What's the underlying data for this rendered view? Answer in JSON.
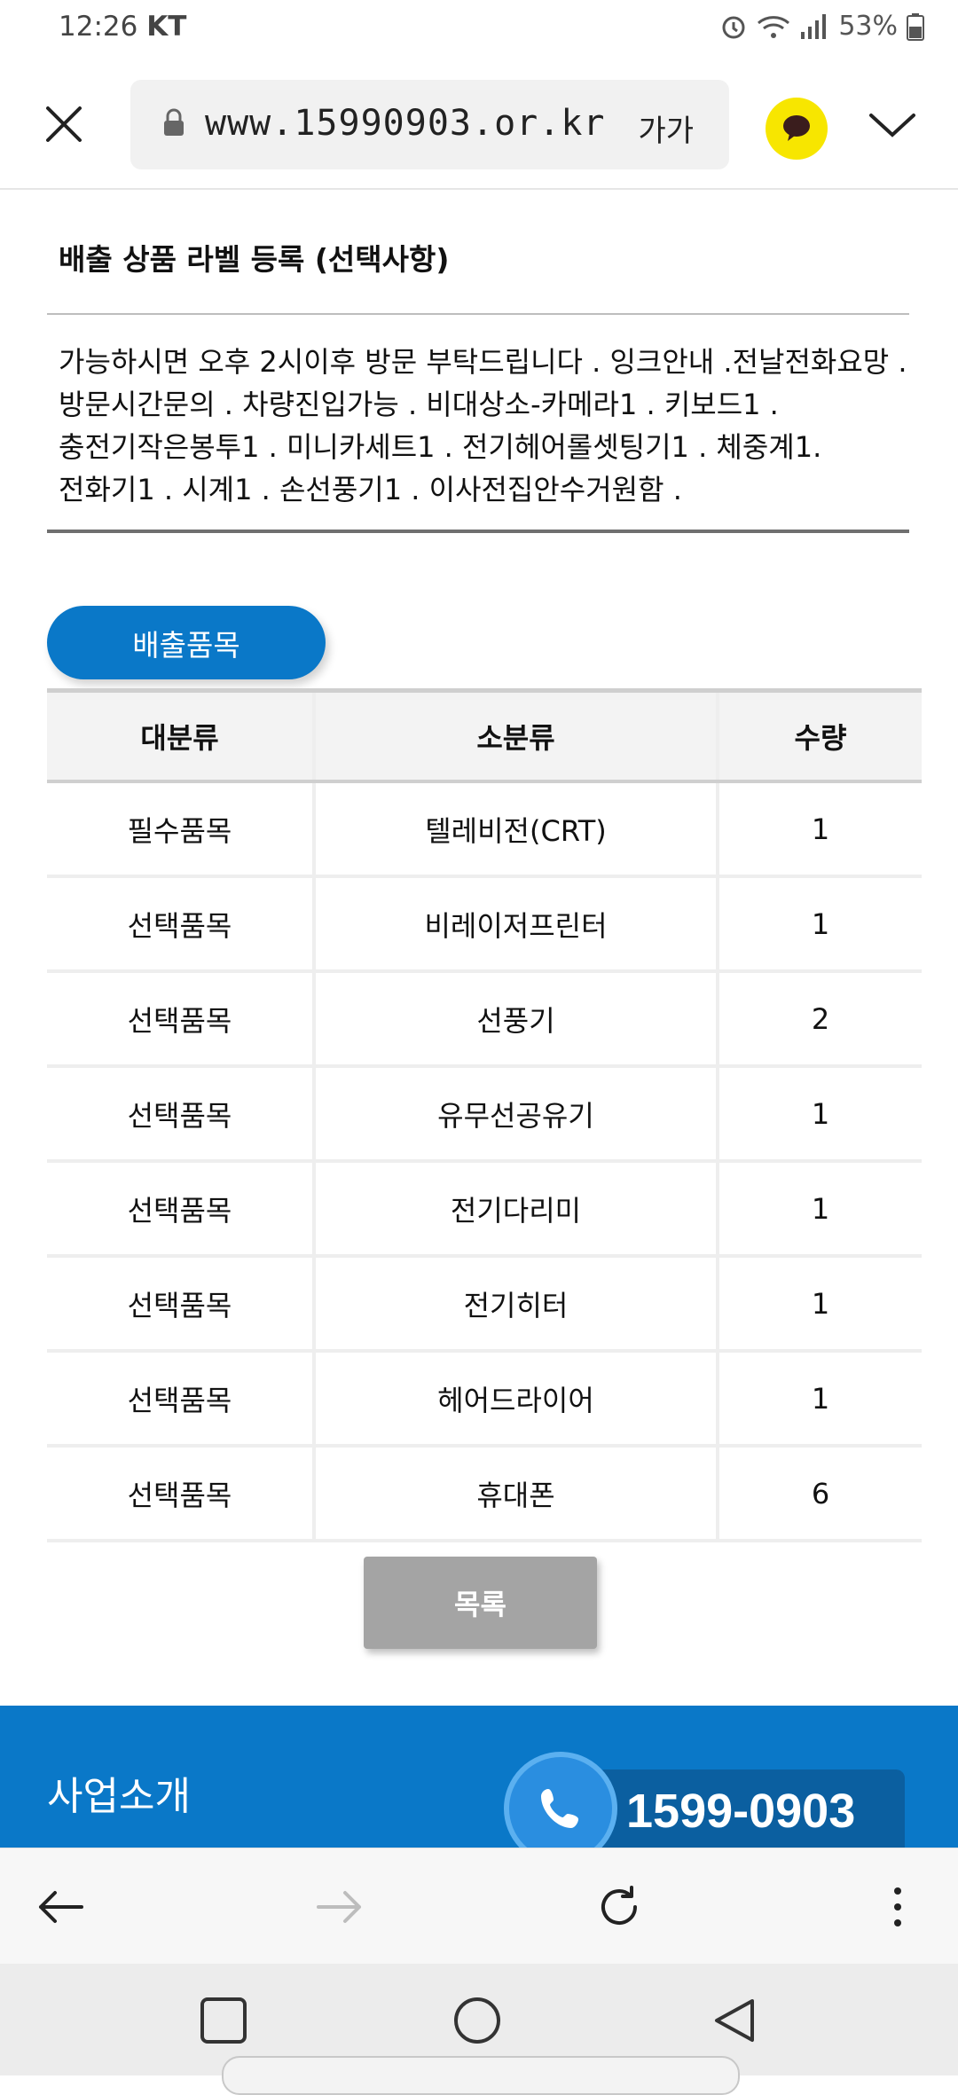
{
  "status_bar": {
    "time": "12:26",
    "carrier": "KT",
    "battery": "53%"
  },
  "browser": {
    "url": "www.15990903.or.kr",
    "text_size_label": "가가"
  },
  "page": {
    "section_title": "배출 상품 라벨 등록 (선택사항)",
    "memo": "가능하시면 오후 2시이후 방문 부탁드립니다 . 잉크안내 .전날전화요망 . 방문시간문의 . 차량진입가능 .  비대상소-카메라1 . 키보드1 . 충전기작은봉투1 . 미니카세트1 . 전기헤어롤셋팅기1 . 체중계1. 전화기1 . 시계1 . 손선풍기1 .  이사전집안수거원함  .",
    "tab_label": "배출품목",
    "table": {
      "headers": [
        "대분류",
        "소분류",
        "수량"
      ],
      "rows": [
        [
          "필수품목",
          "텔레비전(CRT)",
          "1"
        ],
        [
          "선택품목",
          "비레이저프린터",
          "1"
        ],
        [
          "선택품목",
          "선풍기",
          "2"
        ],
        [
          "선택품목",
          "유무선공유기",
          "1"
        ],
        [
          "선택품목",
          "전기다리미",
          "1"
        ],
        [
          "선택품목",
          "전기히터",
          "1"
        ],
        [
          "선택품목",
          "헤어드라이어",
          "1"
        ],
        [
          "선택품목",
          "휴대폰",
          "6"
        ]
      ]
    },
    "list_button": "목록"
  },
  "footer": {
    "intro": "사업소개",
    "phone": "1599-0903"
  },
  "colors": {
    "accent_blue": "#0a78c8",
    "kakao_yellow": "#f7e600",
    "button_gray": "#a4a4a4"
  },
  "icons": {
    "close": "close-icon",
    "lock": "lock-icon",
    "kakao": "kakao-talk-icon",
    "dropdown": "chevron-down-icon",
    "back": "back-arrow-icon",
    "forward": "forward-arrow-icon",
    "refresh": "refresh-icon",
    "menu": "more-vert-icon",
    "phone": "phone-icon"
  }
}
